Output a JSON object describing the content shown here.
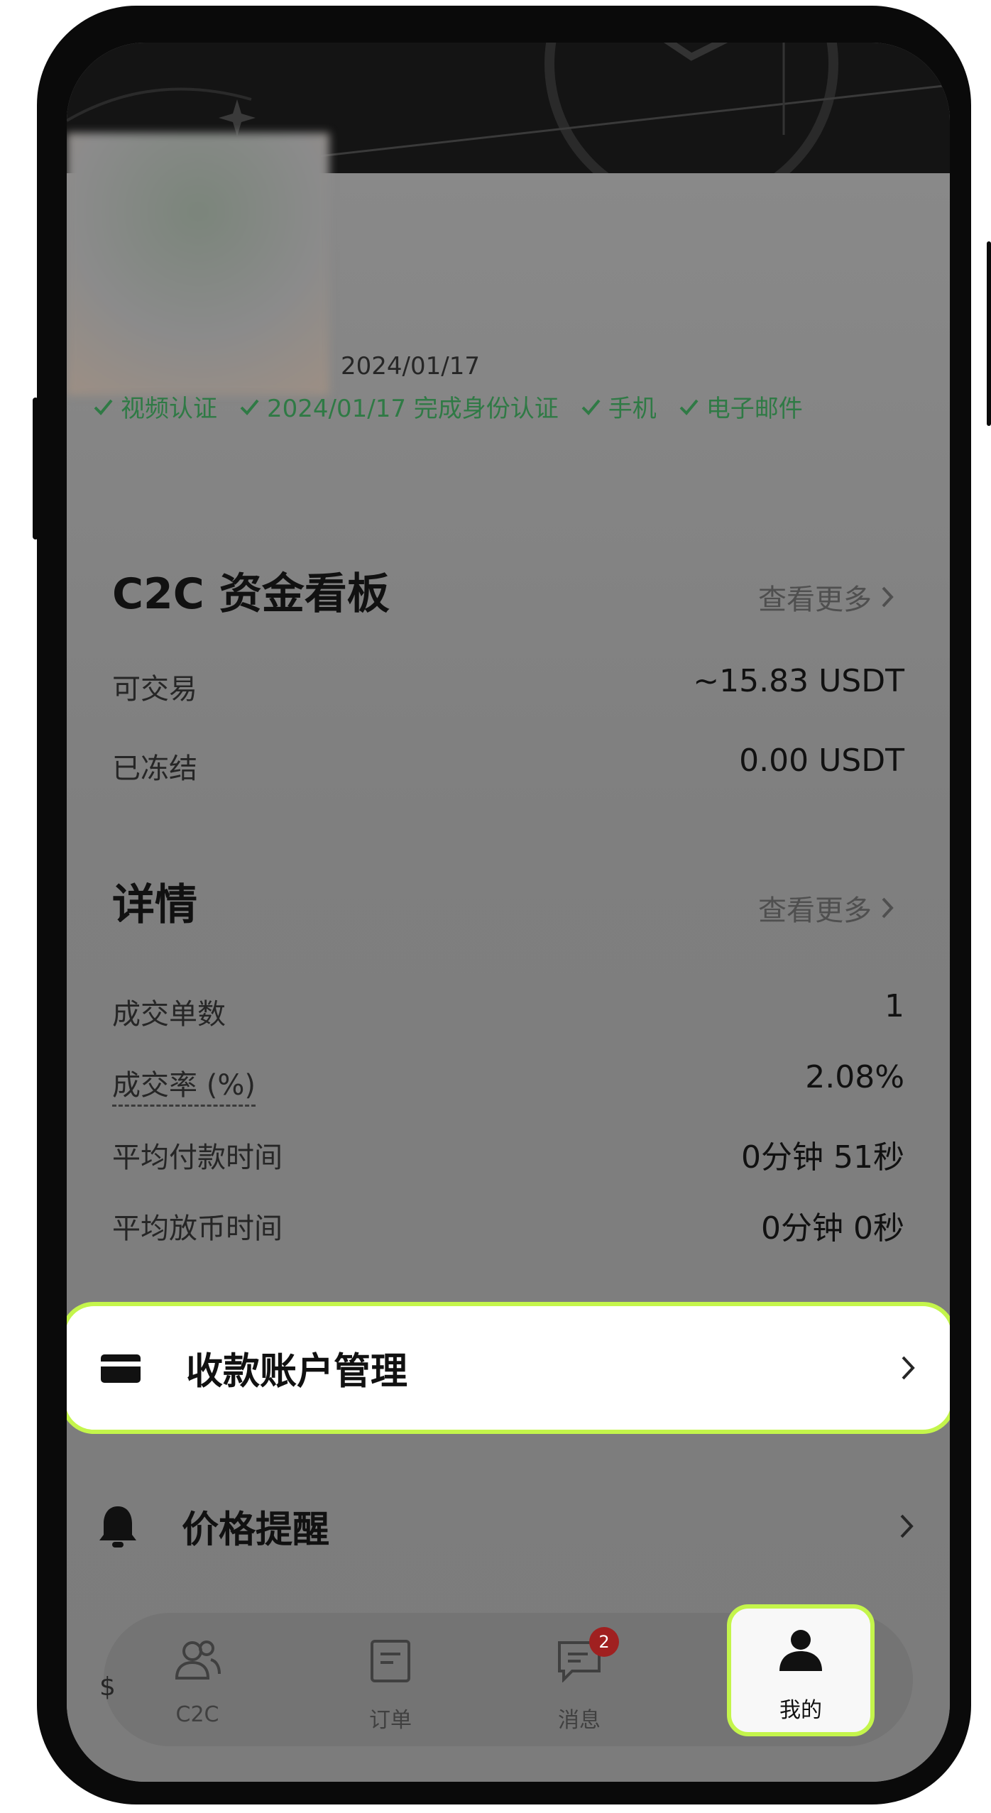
{
  "profile": {
    "join_date": "2024/01/17",
    "badges": [
      "视频认证",
      "2024/01/17 完成身份认证",
      "手机",
      "电子邮件"
    ]
  },
  "funds": {
    "title": "C2C 资金看板",
    "more_label": "查看更多",
    "rows": [
      {
        "label": "可交易",
        "value": "~15.83 USDT"
      },
      {
        "label": "已冻结",
        "value": "0.00 USDT"
      }
    ]
  },
  "details": {
    "title": "详情",
    "more_label": "查看更多",
    "rows": [
      {
        "label": "成交单数",
        "value": "1"
      },
      {
        "label": "成交率 (%)",
        "value": "2.08%"
      },
      {
        "label": "平均付款时间",
        "value": "0分钟 51秒"
      },
      {
        "label": "平均放币时间",
        "value": "0分钟 0秒"
      }
    ]
  },
  "menu": {
    "payment_accounts": "收款账户管理",
    "price_alert": "价格提醒"
  },
  "nav": {
    "items": [
      {
        "label": "C2C",
        "icon": "users-icon"
      },
      {
        "label": "订单",
        "icon": "order-icon"
      },
      {
        "label": "消息",
        "icon": "message-icon",
        "badge": "2"
      },
      {
        "label": "我的",
        "icon": "profile-icon"
      }
    ]
  },
  "colors": {
    "highlight": "#c4f54b",
    "verified": "#2f7a45",
    "notification": "#a02020"
  }
}
